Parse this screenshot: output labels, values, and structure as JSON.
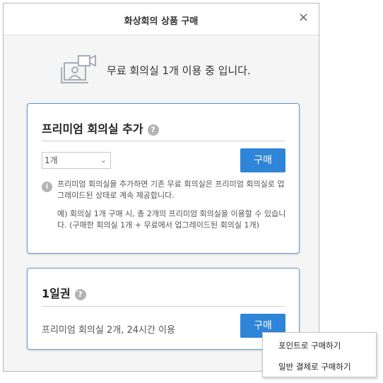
{
  "dialog": {
    "title": "화상회의 상품 구매",
    "close_label": "×"
  },
  "notice": {
    "icon": "video-camera-icon",
    "text": "무료 회의실 1개 이용 중 입니다."
  },
  "premium_card": {
    "title": "프리미엄 회의실 추가",
    "help_icon": "?",
    "quantity": {
      "selected": "1개",
      "chevron": "⌄"
    },
    "buy_label": "구매",
    "info_icon": "i",
    "info_text": "프리미엄 회의실을 추가하면 기존 무료 회의실은 프리미엄 회의실로 업그레이드된 상태로 계속 제공합니다.",
    "example_text": "예) 회의실 1개 구매 시, 총 2개의 프리미엄 회의실을 이용할 수 있습니다. (구매한 회의실 1개 + 무료에서 업그레이드된 회의실 1개)"
  },
  "day_pass_card": {
    "title": "1일권",
    "help_icon": "?",
    "description": "프리미엄 회의실 2개, 24시간 이용",
    "buy_label": "구매"
  },
  "popup_menu": {
    "items": [
      {
        "label": "포인트로 구매하기"
      },
      {
        "label": "일반 결제로 구매하기"
      }
    ]
  },
  "colors": {
    "accent": "#2f85d8",
    "card_border": "#5b9bd5",
    "background": "#f5f5f5"
  }
}
